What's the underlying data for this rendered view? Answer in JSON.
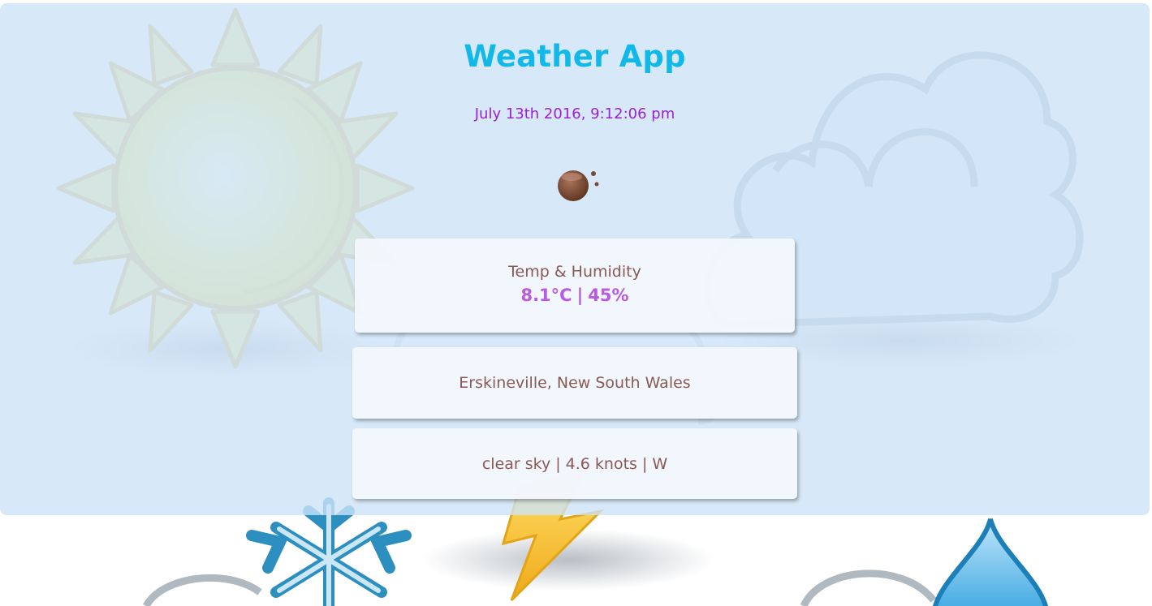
{
  "app": {
    "title": "Weather App",
    "datetime": "July 13th 2016, 9:12:06 pm"
  },
  "icon": {
    "name": "weather-condition-icon"
  },
  "temp_card": {
    "label": "Temp & Humidity",
    "temperature": "8.1°C",
    "separator": "|",
    "humidity": "45%"
  },
  "location_card": {
    "location": "Erskineville, New South Wales"
  },
  "wind_card": {
    "description": "clear sky",
    "speed": "4.6 knots",
    "direction": "W",
    "separator": "|"
  },
  "colors": {
    "title": "#12b8e8",
    "datetime": "#9a1fd6",
    "card_text": "#8a5a52",
    "values": "#b95ae0",
    "panel": "#cde4f8"
  }
}
